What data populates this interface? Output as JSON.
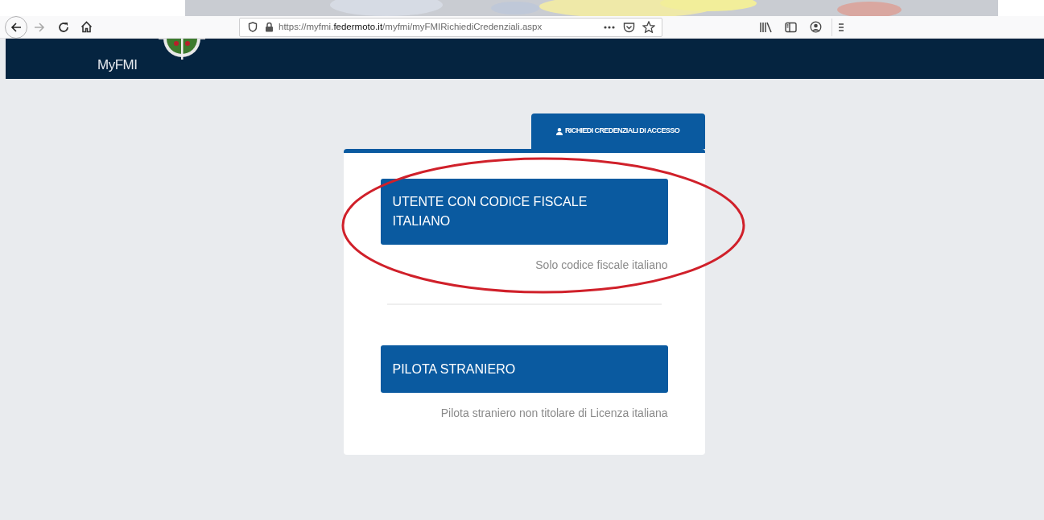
{
  "browser": {
    "url_parts": [
      {
        "text": "https://myfmi.",
        "emphasized": false
      },
      {
        "text": "federmoto.it",
        "emphasized": true
      },
      {
        "text": "/myfmi/myFMIRichiediCredenziali.aspx",
        "emphasized": false
      }
    ]
  },
  "header": {
    "brand": "MyFMI"
  },
  "tabs": [
    {
      "label": "RICHIEDI CREDENZIALI DI ACCESSO",
      "selected": true
    }
  ],
  "options": [
    {
      "button": "UTENTE CON CODICE FISCALE ITALIANO",
      "caption": "Solo codice fiscale italiano",
      "annotated": true
    },
    {
      "button": "PILOTA STRANIERO",
      "caption": "Pilota straniero non titolare di Licenza italiana",
      "annotated": false
    }
  ]
}
